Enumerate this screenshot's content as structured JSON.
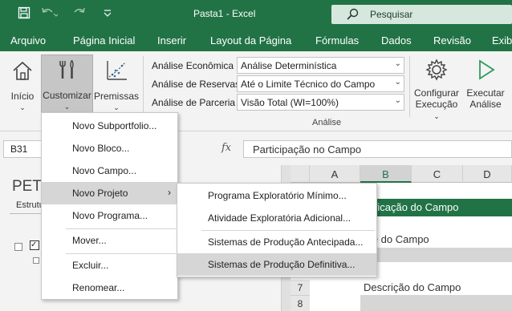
{
  "window": {
    "title": "Pasta1 - Excel"
  },
  "search": {
    "placeholder": "Pesquisar"
  },
  "tabs": [
    "Arquivo",
    "Página Inicial",
    "Inserir",
    "Layout da Página",
    "Fórmulas",
    "Dados",
    "Revisão",
    "Exib"
  ],
  "ribbon": {
    "inicio": "Início",
    "customizar": "Customizar",
    "premissas": "Premissas",
    "analise_economica_label": "Análise Econômica",
    "analise_economica_value": "Análise Determinística",
    "analise_reservas_label": "Análise de Reservas",
    "analise_reservas_value": "Até o Limite Técnico do Campo",
    "analise_parceria_label": "Análise de Parceria",
    "analise_parceria_value": "Visão Total (WI=100%)",
    "configurar_1": "Configurar",
    "configurar_2": "Execução",
    "executar_1": "Executar",
    "executar_2": "Análise",
    "group_label": "Análise"
  },
  "formula_bar": {
    "name_box": "B31",
    "fx": "fx",
    "formula": "Participação no Campo"
  },
  "sheet": {
    "pane_title": "PET",
    "pane_subtitle": "Estrutu",
    "columns": [
      "A",
      "B",
      "C",
      "D"
    ],
    "rows": [
      "7",
      "8"
    ],
    "band_text": "ntificação do Campo",
    "cell_name": "me do Campo",
    "cell_desc": "Descrição do Campo"
  },
  "menu": {
    "items": [
      "Novo Subportfolio...",
      "Novo Bloco...",
      "Novo Campo...",
      "Novo Projeto",
      "Novo Programa...",
      "Mover...",
      "Excluir...",
      "Renomear..."
    ],
    "submenu_chevron": "›"
  },
  "submenu": {
    "items": [
      "Programa Exploratório Mínimo...",
      "Atividade Exploratória Adicional...",
      "Sistemas de Produção Antecipada...",
      "Sistemas de Produção Definitiva..."
    ]
  },
  "colors": {
    "excel_green": "#217346",
    "ribbon_bg": "#f3f3f3",
    "hover": "#d6d6d6"
  }
}
